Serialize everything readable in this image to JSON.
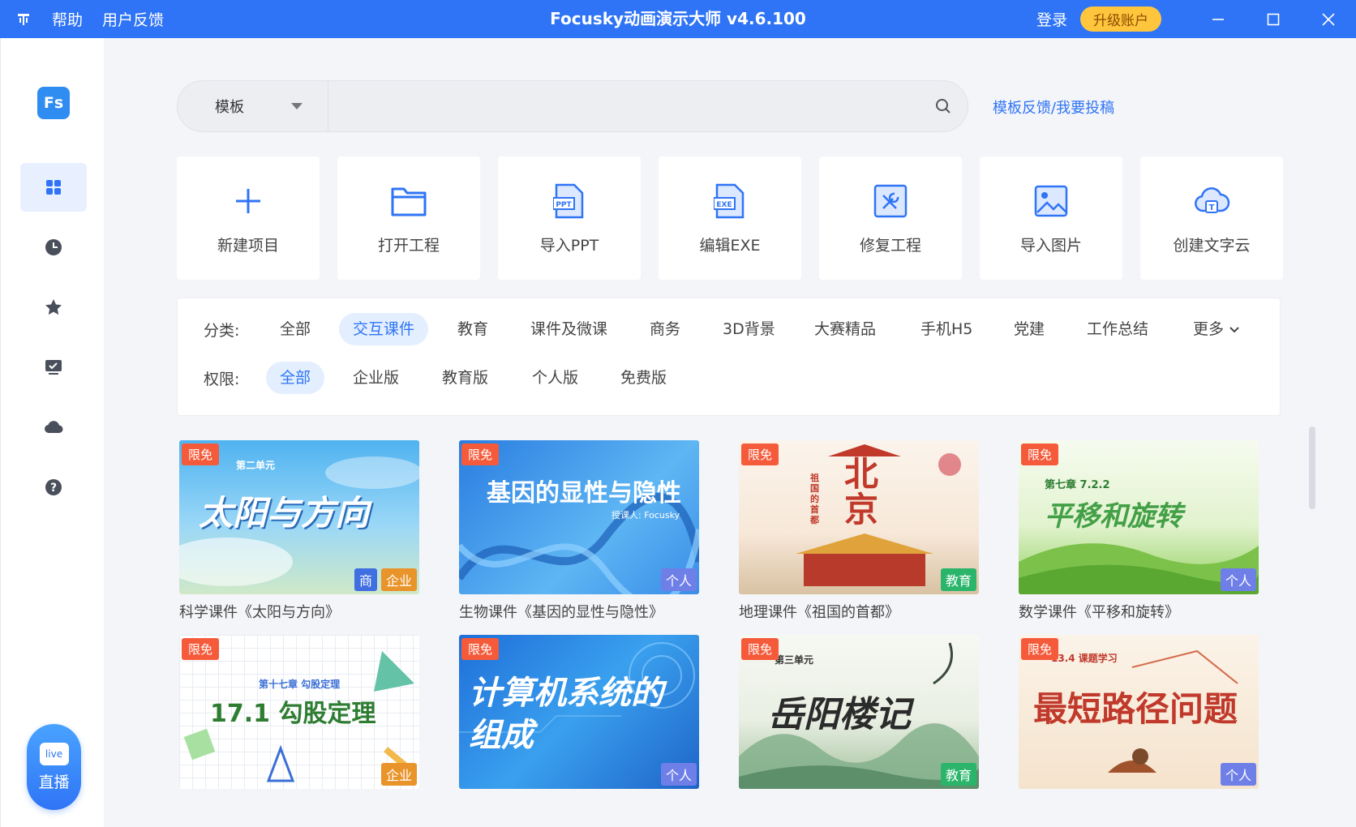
{
  "titlebar": {
    "menu": [
      "帮助",
      "用户反馈"
    ],
    "title": "Focusky动画演示大师 v4.6.100",
    "login": "登录",
    "upgrade": "升级账户"
  },
  "sidebar": {
    "logo": "Fs",
    "icons": [
      "grid-icon",
      "clock-icon",
      "star-icon",
      "monitor-check-icon",
      "cloud-icon",
      "help-icon"
    ],
    "live_label": "直播",
    "live_icon_text": "live"
  },
  "search": {
    "category": "模板",
    "placeholder": "",
    "feedback_link": "模板反馈/我要投稿"
  },
  "actions": [
    {
      "label": "新建项目",
      "icon": "plus-icon"
    },
    {
      "label": "打开工程",
      "icon": "folder-icon"
    },
    {
      "label": "导入PPT",
      "icon": "ppt-file-icon"
    },
    {
      "label": "编辑EXE",
      "icon": "exe-file-icon"
    },
    {
      "label": "修复工程",
      "icon": "repair-icon"
    },
    {
      "label": "导入图片",
      "icon": "image-icon"
    },
    {
      "label": "创建文字云",
      "icon": "word-cloud-icon"
    }
  ],
  "filters": {
    "category_label": "分类:",
    "categories": [
      "全部",
      "交互课件",
      "教育",
      "课件及微课",
      "商务",
      "3D背景",
      "大赛精品",
      "手机H5",
      "党建",
      "工作总结",
      "更多"
    ],
    "category_active": "交互课件",
    "permission_label": "权限:",
    "permissions": [
      "全部",
      "企业版",
      "教育版",
      "个人版",
      "免费版"
    ],
    "permission_active": "全部"
  },
  "templates": [
    {
      "name": "科学课件《太阳与方向》",
      "thumb_title": "太阳与方向",
      "thumb_sub": "第二单元",
      "free": "限免",
      "edition": "企业",
      "extra": "商"
    },
    {
      "name": "生物课件《基因的显性与隐性》",
      "thumb_title": "基因的显性与隐性",
      "thumb_sub": "授课人: Focusky",
      "free": "限免",
      "edition": "个人"
    },
    {
      "name": "地理课件《祖国的首都》",
      "thumb_title": "北京",
      "thumb_sub": "祖国的首都",
      "free": "限免",
      "edition": "教育"
    },
    {
      "name": "数学课件《平移和旋转》",
      "thumb_title": "平移和旋转",
      "thumb_sub": "第七章 7.2.2",
      "free": "限免",
      "edition": "个人"
    },
    {
      "name": "",
      "thumb_title": "17.1 勾股定理",
      "thumb_sub": "第十七章 勾股定理",
      "free": "限免",
      "edition": "企业"
    },
    {
      "name": "",
      "thumb_title": "计算机系统的组成",
      "thumb_sub": "",
      "free": "限免",
      "edition": "个人"
    },
    {
      "name": "",
      "thumb_title": "岳阳楼记",
      "thumb_sub": "第三单元",
      "free": "限免",
      "edition": "教育"
    },
    {
      "name": "",
      "thumb_title": "最短路径问题",
      "thumb_sub": "13.4 课题学习",
      "free": "限免",
      "edition": "个人"
    }
  ]
}
